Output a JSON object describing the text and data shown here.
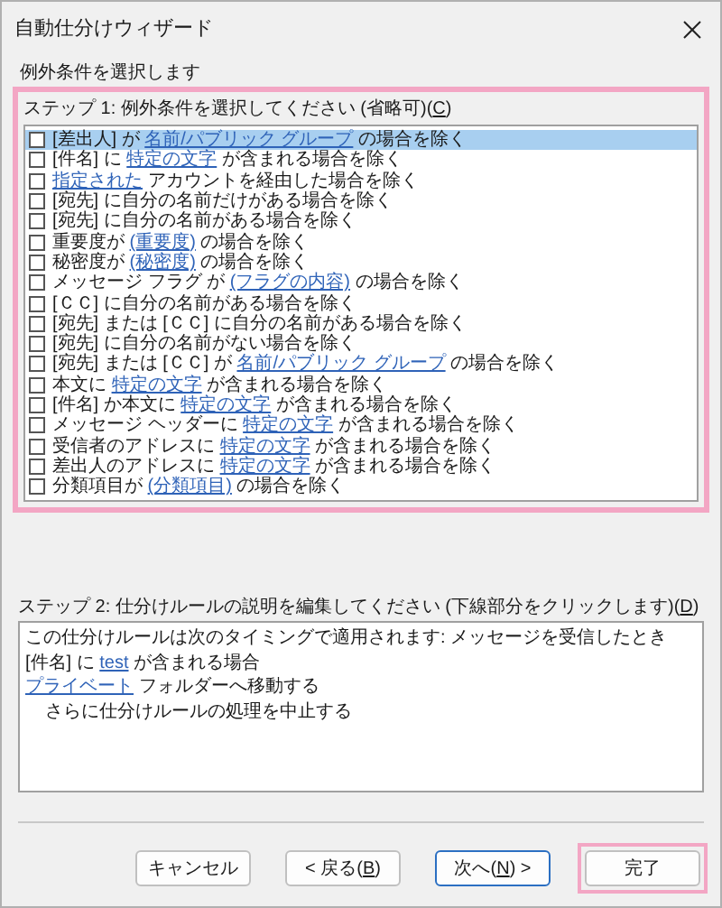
{
  "window": {
    "title": "自動仕分けウィザード"
  },
  "heading": "例外条件を選択します",
  "step1": {
    "highlighted": true,
    "label": [
      {
        "text": "ステップ 1: 例外条件を選択してください (省略可)(",
        "kind": "plain"
      },
      {
        "text": "C",
        "kind": "accesskey"
      },
      {
        "text": ")",
        "kind": "plain"
      }
    ],
    "conditions": [
      {
        "checked": false,
        "selected": true,
        "parts": [
          {
            "text": "[差出人] が ",
            "kind": "plain"
          },
          {
            "text": "名前/パブリック グループ",
            "kind": "link"
          },
          {
            "text": " の場合を除く",
            "kind": "plain"
          }
        ]
      },
      {
        "checked": false,
        "selected": false,
        "parts": [
          {
            "text": "[件名] に ",
            "kind": "plain"
          },
          {
            "text": "特定の文字",
            "kind": "link"
          },
          {
            "text": " が含まれる場合を除く",
            "kind": "plain"
          }
        ]
      },
      {
        "checked": false,
        "selected": false,
        "parts": [
          {
            "text": "指定された",
            "kind": "link"
          },
          {
            "text": " アカウントを経由した場合を除く",
            "kind": "plain"
          }
        ]
      },
      {
        "checked": false,
        "selected": false,
        "parts": [
          {
            "text": "[宛先] に自分の名前だけがある場合を除く",
            "kind": "plain"
          }
        ]
      },
      {
        "checked": false,
        "selected": false,
        "parts": [
          {
            "text": "[宛先] に自分の名前がある場合を除く",
            "kind": "plain"
          }
        ]
      },
      {
        "checked": false,
        "selected": false,
        "parts": [
          {
            "text": "重要度が ",
            "kind": "plain"
          },
          {
            "text": "(重要度)",
            "kind": "link"
          },
          {
            "text": " の場合を除く",
            "kind": "plain"
          }
        ]
      },
      {
        "checked": false,
        "selected": false,
        "parts": [
          {
            "text": "秘密度が ",
            "kind": "plain"
          },
          {
            "text": "(秘密度)",
            "kind": "link"
          },
          {
            "text": " の場合を除く",
            "kind": "plain"
          }
        ]
      },
      {
        "checked": false,
        "selected": false,
        "parts": [
          {
            "text": "メッセージ フラグ が ",
            "kind": "plain"
          },
          {
            "text": "(フラグの内容)",
            "kind": "link"
          },
          {
            "text": " の場合を除く",
            "kind": "plain"
          }
        ]
      },
      {
        "checked": false,
        "selected": false,
        "parts": [
          {
            "text": "[ＣＣ] に自分の名前がある場合を除く",
            "kind": "plain"
          }
        ]
      },
      {
        "checked": false,
        "selected": false,
        "parts": [
          {
            "text": "[宛先] または [ＣＣ] に自分の名前がある場合を除く",
            "kind": "plain"
          }
        ]
      },
      {
        "checked": false,
        "selected": false,
        "parts": [
          {
            "text": "[宛先] に自分の名前がない場合を除く",
            "kind": "plain"
          }
        ]
      },
      {
        "checked": false,
        "selected": false,
        "parts": [
          {
            "text": "[宛先] または [ＣＣ] が ",
            "kind": "plain"
          },
          {
            "text": "名前/パブリック グループ",
            "kind": "link"
          },
          {
            "text": " の場合を除く",
            "kind": "plain"
          }
        ]
      },
      {
        "checked": false,
        "selected": false,
        "parts": [
          {
            "text": "本文に ",
            "kind": "plain"
          },
          {
            "text": "特定の文字",
            "kind": "link"
          },
          {
            "text": " が含まれる場合を除く",
            "kind": "plain"
          }
        ]
      },
      {
        "checked": false,
        "selected": false,
        "parts": [
          {
            "text": "[件名] か本文に ",
            "kind": "plain"
          },
          {
            "text": "特定の文字",
            "kind": "link"
          },
          {
            "text": " が含まれる場合を除く",
            "kind": "plain"
          }
        ]
      },
      {
        "checked": false,
        "selected": false,
        "parts": [
          {
            "text": "メッセージ ヘッダーに ",
            "kind": "plain"
          },
          {
            "text": "特定の文字",
            "kind": "link"
          },
          {
            "text": " が含まれる場合を除く",
            "kind": "plain"
          }
        ]
      },
      {
        "checked": false,
        "selected": false,
        "parts": [
          {
            "text": "受信者のアドレスに ",
            "kind": "plain"
          },
          {
            "text": "特定の文字",
            "kind": "link"
          },
          {
            "text": " が含まれる場合を除く",
            "kind": "plain"
          }
        ]
      },
      {
        "checked": false,
        "selected": false,
        "parts": [
          {
            "text": "差出人のアドレスに ",
            "kind": "plain"
          },
          {
            "text": "特定の文字",
            "kind": "link"
          },
          {
            "text": " が含まれる場合を除く",
            "kind": "plain"
          }
        ]
      },
      {
        "checked": false,
        "selected": false,
        "parts": [
          {
            "text": "分類項目が ",
            "kind": "plain"
          },
          {
            "text": "(分類項目)",
            "kind": "link"
          },
          {
            "text": " の場合を除く",
            "kind": "plain"
          }
        ]
      }
    ]
  },
  "step2": {
    "label": [
      {
        "text": "ステップ 2: 仕分けルールの説明を編集してください (下線部分をクリックします)(",
        "kind": "plain"
      },
      {
        "text": "D",
        "kind": "accesskey"
      },
      {
        "text": ")",
        "kind": "plain"
      }
    ],
    "lines": [
      {
        "indented": false,
        "parts": [
          {
            "text": "この仕分けルールは次のタイミングで適用されます: メッセージを受信したとき",
            "kind": "plain"
          }
        ]
      },
      {
        "indented": false,
        "parts": [
          {
            "text": "[件名] に ",
            "kind": "plain"
          },
          {
            "text": "test",
            "kind": "link"
          },
          {
            "text": " が含まれる場合",
            "kind": "plain"
          }
        ]
      },
      {
        "indented": false,
        "parts": [
          {
            "text": "プライベート",
            "kind": "link"
          },
          {
            "text": " フォルダーへ移動する",
            "kind": "plain"
          }
        ]
      },
      {
        "indented": true,
        "parts": [
          {
            "text": "さらに仕分けルールの処理を中止する",
            "kind": "plain"
          }
        ]
      }
    ]
  },
  "buttons": [
    {
      "default": false,
      "highlighted": false,
      "parts": [
        {
          "text": "キャンセル",
          "kind": "plain"
        }
      ]
    },
    {
      "default": false,
      "highlighted": false,
      "parts": [
        {
          "text": "< 戻る(",
          "kind": "plain"
        },
        {
          "text": "B",
          "kind": "accesskey"
        },
        {
          "text": ")",
          "kind": "plain"
        }
      ]
    },
    {
      "default": true,
      "highlighted": false,
      "parts": [
        {
          "text": "次へ(",
          "kind": "plain"
        },
        {
          "text": "N",
          "kind": "accesskey"
        },
        {
          "text": ") >",
          "kind": "plain"
        }
      ]
    },
    {
      "default": false,
      "highlighted": true,
      "parts": [
        {
          "text": "完了",
          "kind": "plain"
        }
      ]
    }
  ]
}
